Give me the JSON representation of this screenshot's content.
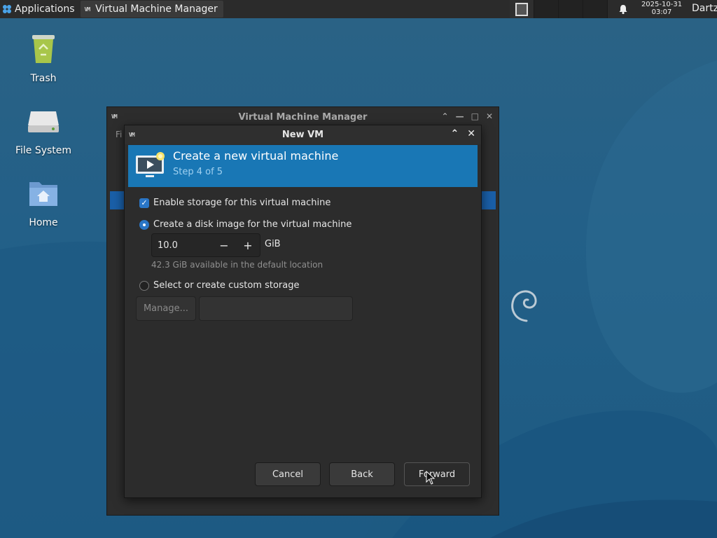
{
  "panel": {
    "applications_label": "Applications",
    "task_label": "Virtual Machine Manager",
    "clock_date": "2025-10-31",
    "clock_time": "03:07",
    "user": "Dartz",
    "icons": [
      "applications-icon",
      "vm-app-icon",
      "workspace-icon",
      "bell-icon"
    ]
  },
  "desktop": {
    "icons": [
      {
        "label": "Trash",
        "icon": "trash-icon"
      },
      {
        "label": "File System",
        "icon": "drive-icon"
      },
      {
        "label": "Home",
        "icon": "home-folder-icon"
      }
    ]
  },
  "back_window": {
    "title": "Virtual Machine Manager",
    "menu_fragment": "Fi"
  },
  "dialog": {
    "title": "New VM",
    "banner_title": "Create a new virtual machine",
    "banner_step": "Step 4 of 5",
    "enable_storage_label": "Enable storage for this virtual machine",
    "enable_storage_checked": true,
    "create_disk_label": "Create a disk image for the virtual machine",
    "disk_size": "10.0",
    "disk_unit": "GiB",
    "minus_symbol": "−",
    "plus_symbol": "+",
    "available_text": "42.3 GiB available in the default location",
    "custom_storage_label": "Select or create custom storage",
    "manage_label": "Manage...",
    "custom_path_value": "",
    "selected_option": "create-disk",
    "buttons": {
      "cancel": "Cancel",
      "back": "Back",
      "forward": "Forward"
    }
  },
  "colors": {
    "banner": "#1977b5",
    "accent": "#2a76c6",
    "panel": "#2b2b2b"
  }
}
